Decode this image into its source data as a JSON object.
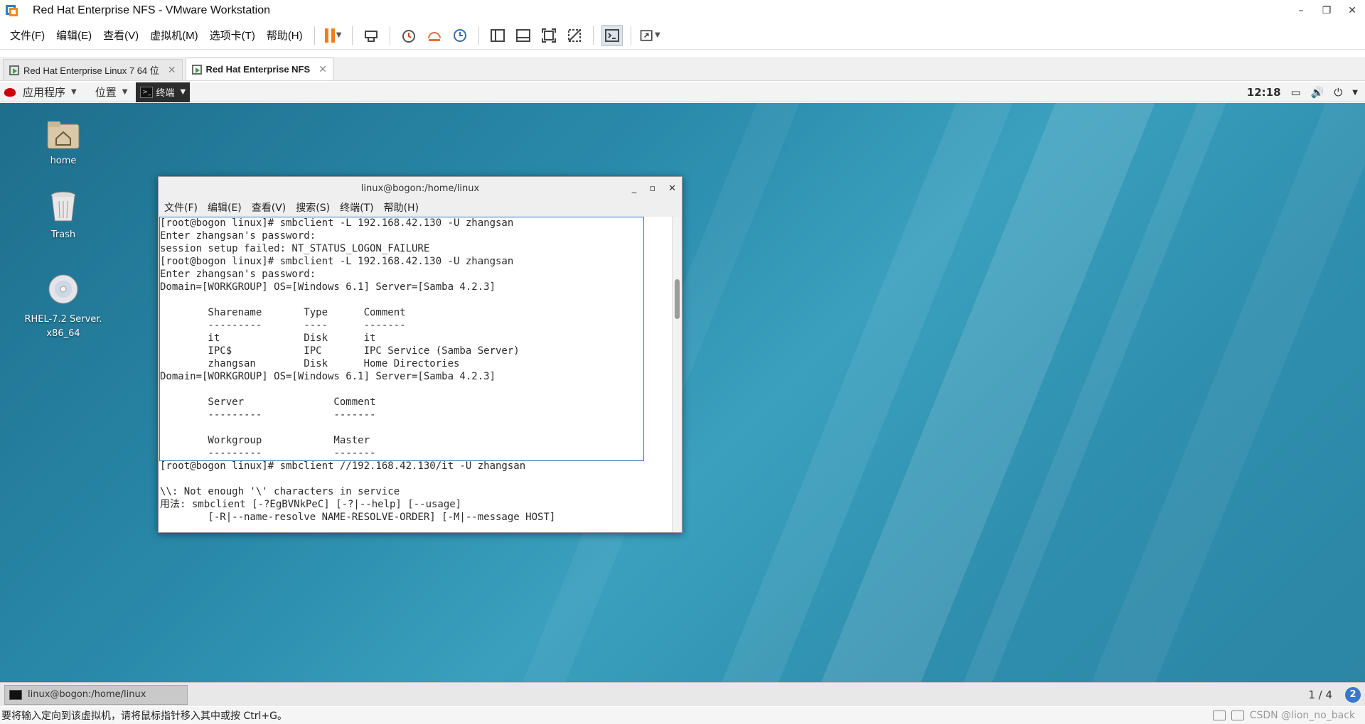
{
  "window": {
    "title": "Red Hat Enterprise NFS - VMware Workstation",
    "minimize": "–",
    "restore": "❐",
    "close": "✕"
  },
  "vm_menu": [
    "文件(F)",
    "编辑(E)",
    "查看(V)",
    "虚拟机(M)",
    "选项卡(T)",
    "帮助(H)"
  ],
  "toolbar_icons": [
    "pause-icon",
    "send-ctrl-alt-del-icon",
    "snapshot-icon",
    "revert-snapshot-icon",
    "snapshot-manager-icon",
    "library-view-icon",
    "thumbnail-view-icon",
    "fullscreen-icon",
    "unity-icon",
    "console-view-icon",
    "stretch-icon"
  ],
  "tabs": [
    {
      "label": "Red Hat Enterprise Linux 7 64 位",
      "close": "✕"
    },
    {
      "label": "Red Hat Enterprise NFS",
      "close": "✕"
    }
  ],
  "gnome_bar": {
    "apps": "应用程序",
    "places": "位置",
    "terminal": "终端",
    "clock": "12:18"
  },
  "desktop_icons": [
    {
      "label": "home"
    },
    {
      "label": "Trash"
    },
    {
      "label": "RHEL-7.2 Server.\nx86_64"
    }
  ],
  "terminal": {
    "title": "linux@bogon:/home/linux",
    "menu": [
      "文件(F)",
      "编辑(E)",
      "查看(V)",
      "搜索(S)",
      "终端(T)",
      "帮助(H)"
    ],
    "lines": [
      "[root@bogon linux]# smbclient -L 192.168.42.130 -U zhangsan",
      "Enter zhangsan's password:",
      "session setup failed: NT_STATUS_LOGON_FAILURE",
      "[root@bogon linux]# smbclient -L 192.168.42.130 -U zhangsan",
      "Enter zhangsan's password:",
      "Domain=[WORKGROUP] OS=[Windows 6.1] Server=[Samba 4.2.3]",
      "",
      "        Sharename       Type      Comment",
      "        ---------       ----      -------",
      "        it              Disk      it",
      "        IPC$            IPC       IPC Service (Samba Server)",
      "        zhangsan        Disk      Home Directories",
      "Domain=[WORKGROUP] OS=[Windows 6.1] Server=[Samba 4.2.3]",
      "",
      "        Server               Comment",
      "        ---------            -------",
      "",
      "        Workgroup            Master",
      "        ---------            -------",
      "[root@bogon linux]# smbclient //192.168.42.130/it -U zhangsan",
      "",
      "\\\\: Not enough '\\' characters in service",
      "用法: smbclient [-?EgBVNkPeC] [-?|--help] [--usage]",
      "        [-R|--name-resolve NAME-RESOLVE-ORDER] [-M|--message HOST]"
    ]
  },
  "taskbar": {
    "item": "linux@bogon:/home/linux",
    "workspace": "1 / 4",
    "help": "2"
  },
  "statusbar": {
    "text": "要将输入定向到该虚拟机，请将鼠标指针移入其中或按 Ctrl+G。",
    "watermark": "CSDN @lion_no_back"
  },
  "colors": {
    "accent_orange": "#f07d1a",
    "selection_blue": "#2c7ac8",
    "desktop_teal": "#2a8aab"
  }
}
